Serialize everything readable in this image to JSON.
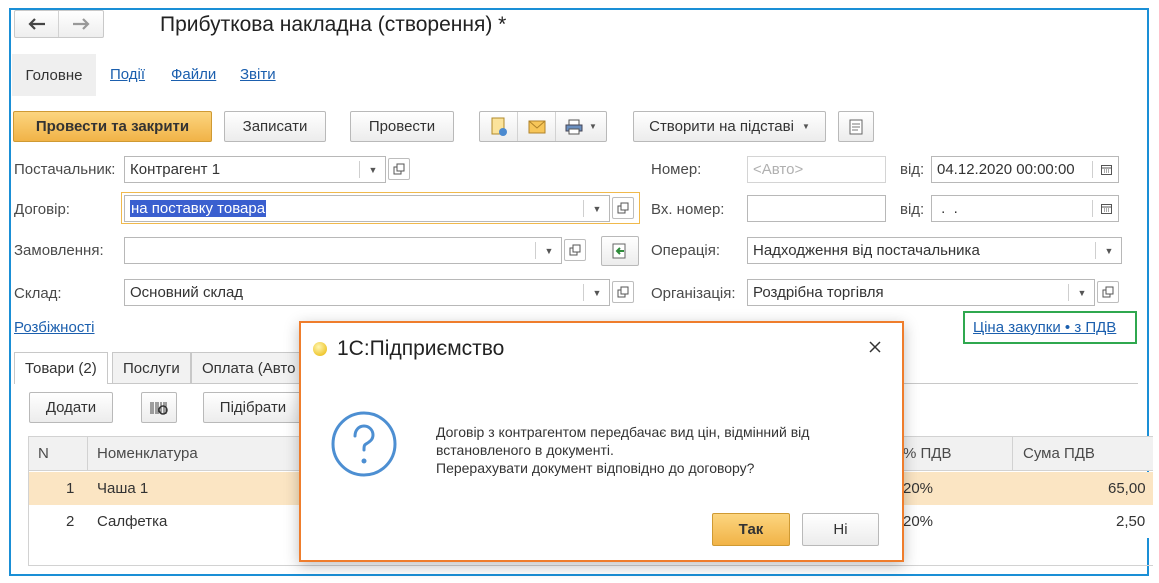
{
  "window": {
    "title": "Прибуткова накладна (створення) *"
  },
  "nav_tabs": [
    "Головне",
    "Події",
    "Файли",
    "Звіти"
  ],
  "toolbar": {
    "post_close": "Провести та закрити",
    "save": "Записати",
    "post": "Провести",
    "create_based": "Створити на підставі"
  },
  "form": {
    "supplier_label": "Постачальник:",
    "supplier_value": "Контрагент 1",
    "contract_label": "Договір:",
    "contract_value": "на поставку товара",
    "order_label": "Замовлення:",
    "order_value": "",
    "warehouse_label": "Склад:",
    "warehouse_value": "Основний склад",
    "number_label": "Номер:",
    "number_placeholder": "<Авто>",
    "date_label": "від:",
    "date_value": "04.12.2020 00:00:00",
    "in_number_label": "Вх. номер:",
    "in_number_value": "",
    "in_date_label": "від:",
    "in_date_value": " .  .",
    "operation_label": "Операція:",
    "operation_value": "Надходження від постачальника",
    "organization_label": "Організація:",
    "organization_value": "Роздрібна торгівля"
  },
  "links": {
    "discrepancies": "Розбіжності",
    "price_type": "Ціна закупки • з ПДВ"
  },
  "doc_tabs": [
    "Товари (2)",
    "Послуги",
    "Оплата (Авто"
  ],
  "table_toolbar": {
    "add": "Додати",
    "pick": "Підібрати"
  },
  "table": {
    "headers": {
      "n": "N",
      "item": "Номенклатура",
      "vat_rate": "% ПДВ",
      "vat_sum": "Сума ПДВ"
    },
    "rows": [
      {
        "n": "1",
        "item": "Чаша 1",
        "vat_rate": "20%",
        "vat_sum": "65,00"
      },
      {
        "n": "2",
        "item": "Салфетка",
        "vat_rate": "20%",
        "vat_sum": "2,50"
      }
    ]
  },
  "dialog": {
    "title": "1С:Підприємство",
    "message_line1": "Договір з контрагентом передбачає вид цін, відмінний від",
    "message_line2": "встановленого в документі.",
    "message_line3": "Перерахувати документ відповідно до договору?",
    "yes": "Так",
    "no": "Ні"
  },
  "colors": {
    "primary_button": "#f4b94f",
    "link": "#1b5fae",
    "frame": "#1a8fd6",
    "dialog_border": "#ef7d2c",
    "highlight_box": "#2fa84f",
    "contract_focus": "#f0b94c",
    "selected_row": "#fbe5c3"
  }
}
